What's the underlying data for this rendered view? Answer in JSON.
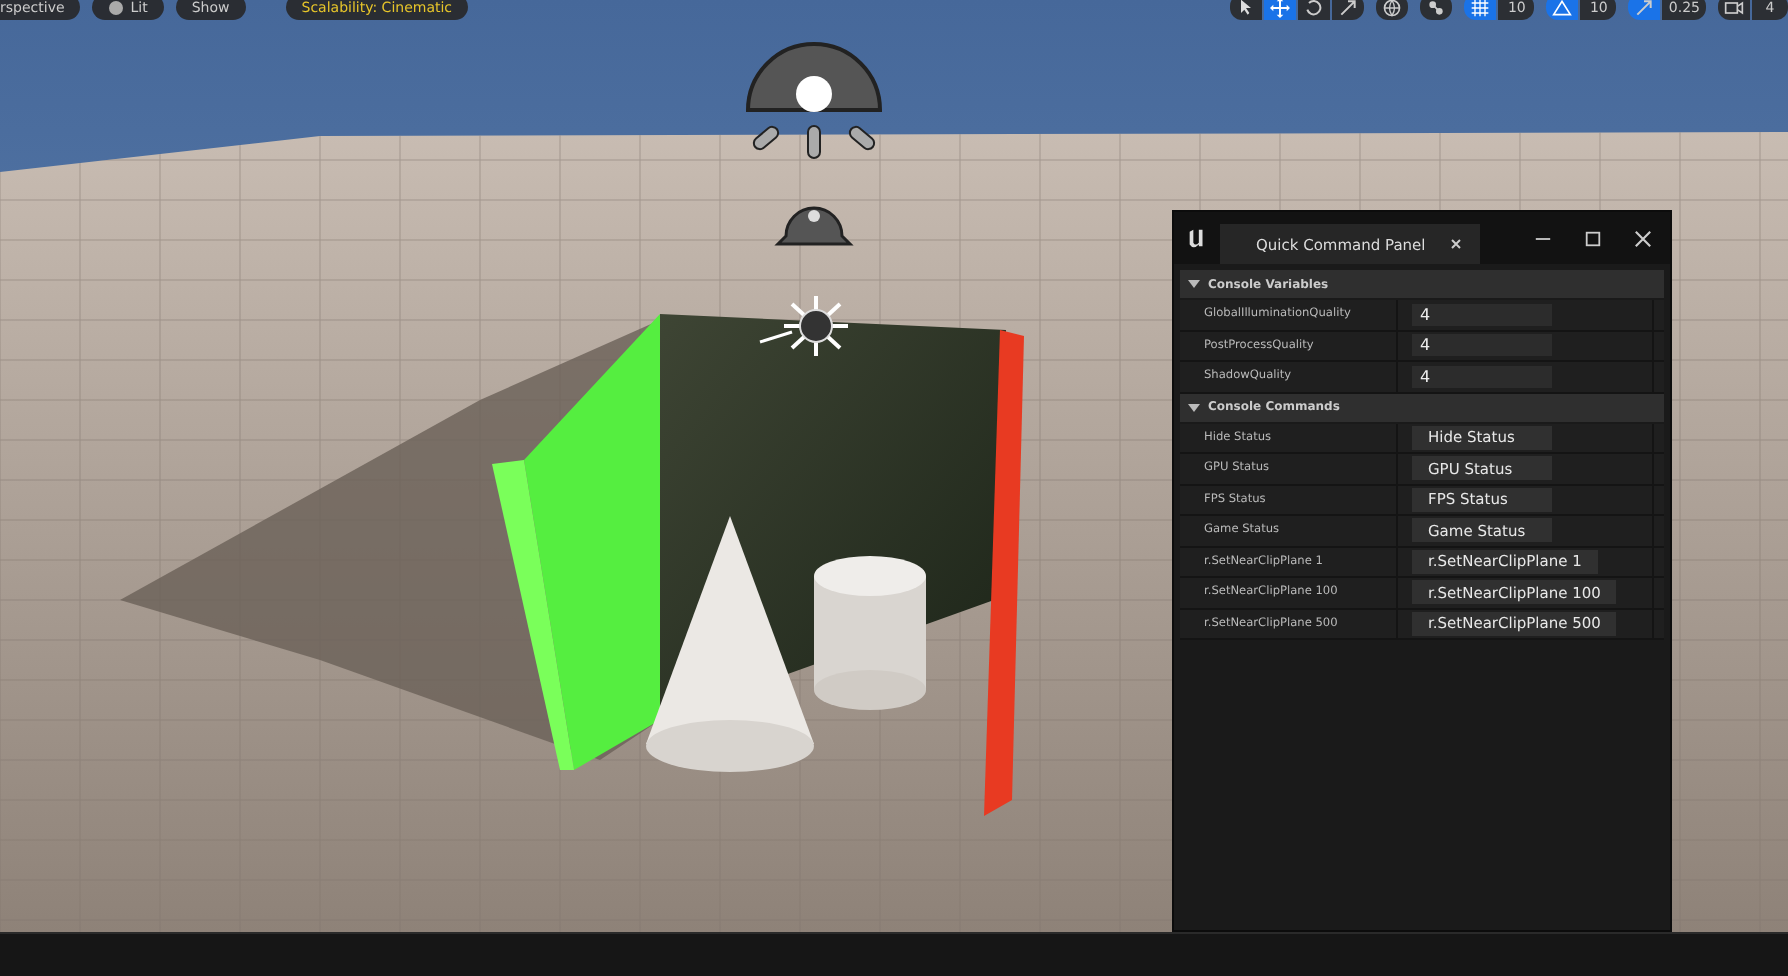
{
  "viewport_toolbar": {
    "left": [
      {
        "kind": "text",
        "label": "rspective"
      },
      {
        "kind": "lit",
        "label": "Lit"
      },
      {
        "kind": "text",
        "label": "Show"
      },
      {
        "kind": "scalability",
        "label": "Scalability: Cinematic"
      }
    ],
    "right": [
      {
        "kind": "tools",
        "items": [
          {
            "selected": false
          },
          {
            "selected": true
          },
          {
            "selected": false
          },
          {
            "selected": false
          }
        ]
      },
      {
        "kind": "icon"
      },
      {
        "kind": "icon"
      },
      {
        "kind": "snap",
        "value": "10",
        "on": true
      },
      {
        "kind": "snap",
        "value": "10",
        "on": true
      },
      {
        "kind": "snap",
        "value": "0.25",
        "on": true
      },
      {
        "kind": "snap",
        "value": "4",
        "on": false
      }
    ]
  },
  "panel": {
    "tab_title": "Quick Command Panel",
    "sections": [
      {
        "title": "Console Variables",
        "expanded": true,
        "rows": [
          {
            "kind": "field",
            "label": "GlobalIlluminationQuality",
            "value": "4"
          },
          {
            "kind": "field",
            "label": "PostProcessQuality",
            "value": "4"
          },
          {
            "kind": "field",
            "label": "ShadowQuality",
            "value": "4"
          }
        ]
      },
      {
        "title": "Console Commands",
        "expanded": true,
        "rows": [
          {
            "kind": "button",
            "label": "Hide Status",
            "button": "Hide Status"
          },
          {
            "kind": "button",
            "label": "GPU Status",
            "button": "GPU Status"
          },
          {
            "kind": "button",
            "label": "FPS Status",
            "button": "FPS Status"
          },
          {
            "kind": "button",
            "label": "Game Status",
            "button": "Game Status"
          },
          {
            "kind": "button",
            "label": "r.SetNearClipPlane 1",
            "button": "r.SetNearClipPlane 1"
          },
          {
            "kind": "button",
            "label": "r.SetNearClipPlane 100",
            "button": "r.SetNearClipPlane 100"
          },
          {
            "kind": "button",
            "label": "r.SetNearClipPlane 500",
            "button": "r.SetNearClipPlane 500"
          }
        ]
      }
    ]
  }
}
